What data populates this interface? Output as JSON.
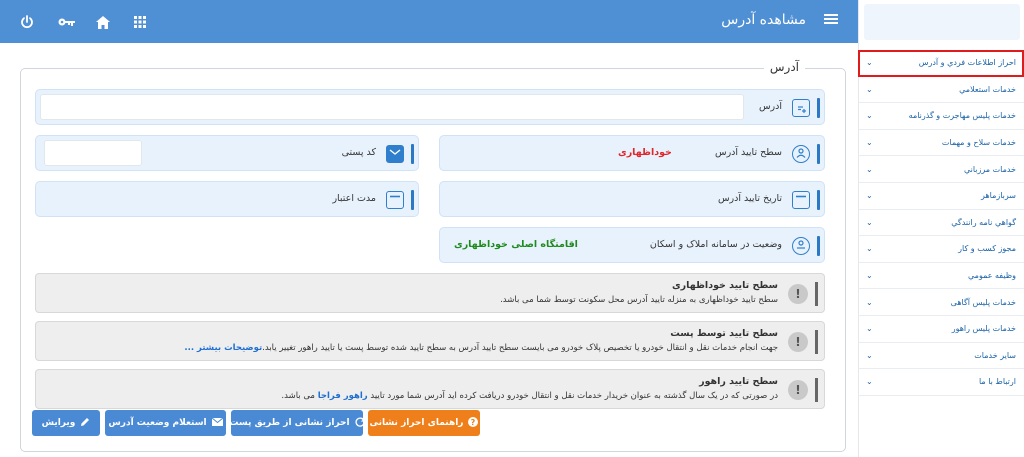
{
  "header": {
    "title": "مشاهده آدرس",
    "menu_icon": "hamburger-icon",
    "icons": [
      "power-icon",
      "key-icon",
      "home-icon",
      "grid-icon"
    ]
  },
  "sidebar": {
    "items": [
      {
        "label": "احراز اطلاعات فردي و آدرس",
        "active": true
      },
      {
        "label": "خدمات استعلامي"
      },
      {
        "label": "خدمات پليس مهاجرت و گذرنامه"
      },
      {
        "label": "خدمات سلاح و مهمات"
      },
      {
        "label": "خدمات مرزباني"
      },
      {
        "label": "سربازماهر"
      },
      {
        "label": "گواهي نامه رانندگي"
      },
      {
        "label": "مجوز کسب و کار"
      },
      {
        "label": "وظيفه عمومي"
      },
      {
        "label": "خدمات پلیس آگاهی"
      },
      {
        "label": "خدمات پليس راهور"
      },
      {
        "label": "ساير خدمات"
      },
      {
        "label": "ارتباط با ما"
      }
    ]
  },
  "card": {
    "legend": "آدرس",
    "address": {
      "label": "آدرس",
      "value": ""
    },
    "postal_code": {
      "label": "کد پستی",
      "value": ""
    },
    "verification_level": {
      "label": "سطح تایید آدرس",
      "value": "خوداظهاری"
    },
    "validity": {
      "label": "مدت اعتبار",
      "value": ""
    },
    "verification_date": {
      "label": "تاریخ تایید آدرس",
      "value": ""
    },
    "registry_status": {
      "label": "وضعیت در سامانه املاک و اسکان",
      "value": "اقامتگاه اصلی خوداظهاری"
    }
  },
  "colors": {
    "header": "#4f8fd4",
    "value_red": "#e0262a",
    "value_green": "#1f8a1f",
    "accent_orange": "#ef7f1a"
  },
  "notes": [
    {
      "title": "سطح تایید خوداظهاری",
      "text": "سطح تایید خوداظهاری به منزله تایید آدرس محل سکونت توسط شما می باشد."
    },
    {
      "title": "سطح تایید توسط پست",
      "text": "جهت انجام خدمات نقل و انتقال خودرو یا تخصیص پلاک خودرو می بایست سطح تایید آدرس به سطح تایید شده توسط پست یا تایید راهور تغییر یابد.",
      "link": "توضیحات بیشتر ..."
    },
    {
      "title": "سطح تایید راهور",
      "text_pre": "در صورتی که در یک سال گذشته به عنوان خریدار خدمات نقل و انتقال خودرو دریافت کرده اید آدرس شما مورد تایید",
      "link": "راهور فراجا",
      "text_post": "می باشد."
    }
  ],
  "buttons": {
    "guide": "راهنمای احراز نشانی",
    "verify_post": "احراز نشانی از طریق پست",
    "inquiry": "استعلام وضعیت آدرس",
    "edit": "ویرایش"
  }
}
